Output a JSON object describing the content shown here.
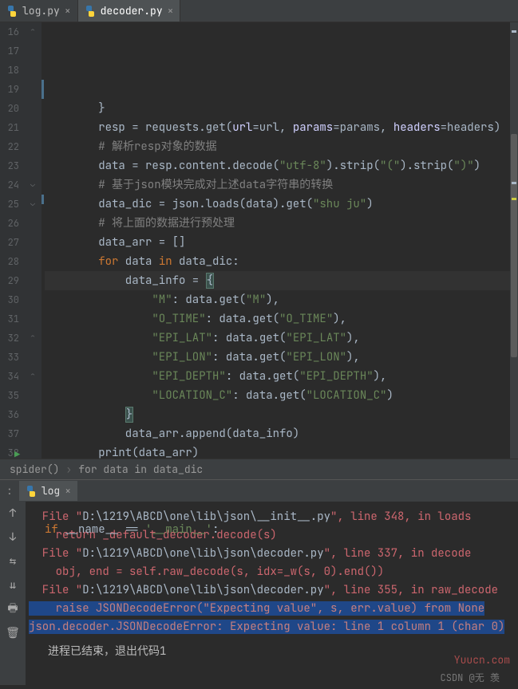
{
  "tabs": {
    "items": [
      {
        "label": "log.py",
        "active": false
      },
      {
        "label": "decoder.py",
        "active": true
      }
    ]
  },
  "gutter": {
    "start": 16,
    "end": 38
  },
  "code": {
    "lines": [
      {
        "n": 16,
        "html": "        }"
      },
      {
        "n": 17,
        "html": "        resp = requests.get(<span class='param'>url</span>=url, <span class='param'>params</span>=params, <span class='param'>headers</span>=headers)"
      },
      {
        "n": 18,
        "html": "        <span class='cmt'># 解析resp对象的数据</span>"
      },
      {
        "n": 19,
        "html": "        data = resp.content.decode(<span class='str'>\"utf-8\"</span>).strip(<span class='str'>\"(\"</span>).strip(<span class='str'>\")\"</span>)"
      },
      {
        "n": 20,
        "html": "        <span class='cmt'># 基于json模块完成对上述data字符串的转换</span>"
      },
      {
        "n": 21,
        "html": "        data_dic = json.loads(data).get(<span class='str'>\"shu ju\"</span>)"
      },
      {
        "n": 22,
        "html": "        <span class='cmt'># 将上面的数据进行预处理</span>"
      },
      {
        "n": 23,
        "html": "        data_arr = []"
      },
      {
        "n": 24,
        "html": "        <span class='kw'>for</span> data <span class='kw'>in</span> data_dic:"
      },
      {
        "n": 25,
        "html": "            data_info = <span class='brace-hl'>{</span>",
        "current": true
      },
      {
        "n": 26,
        "html": "                <span class='str'>\"M\"</span>: data.get(<span class='str'>\"M\"</span>),"
      },
      {
        "n": 27,
        "html": "                <span class='str'>\"O_TIME\"</span>: data.get(<span class='str'>\"O_TIME\"</span>),"
      },
      {
        "n": 28,
        "html": "                <span class='str'>\"EPI_LAT\"</span>: data.get(<span class='str'>\"EPI_LAT\"</span>),"
      },
      {
        "n": 29,
        "html": "                <span class='str'>\"EPI_LON\"</span>: data.get(<span class='str'>\"EPI_LON\"</span>),"
      },
      {
        "n": 30,
        "html": "                <span class='str'>\"EPI_DEPTH\"</span>: data.get(<span class='str'>\"EPI_DEPTH\"</span>),"
      },
      {
        "n": 31,
        "html": "                <span class='str'>\"LOCATION_C\"</span>: data.get(<span class='str'>\"LOCATION_C\"</span>)"
      },
      {
        "n": 32,
        "html": "            <span class='brace-hl'>}</span>"
      },
      {
        "n": 33,
        "html": "            data_arr.append(data_info)"
      },
      {
        "n": 34,
        "html": "        <span class='fn'>print</span>(data_arr)"
      },
      {
        "n": 35,
        "html": ""
      },
      {
        "n": 36,
        "html": ""
      },
      {
        "n": 37,
        "html": ""
      },
      {
        "n": 38,
        "html": "<span class='kw'>if</span> __name__ == <span class='str'>'__main__'</span>:"
      }
    ]
  },
  "breadcrumb": {
    "items": [
      "spider()",
      "for data in data_dic"
    ]
  },
  "tool_window": {
    "prefix": ":",
    "tab_label": "log"
  },
  "console": {
    "lines": [
      {
        "prefix": "  File \"",
        "file": "D:\\1219\\ABCD\\one\\lib\\json\\__init__.py",
        "suffix": "\", line 348, in loads"
      },
      {
        "text": "    return _default_decoder.decode(s)"
      },
      {
        "prefix": "  File \"",
        "file": "D:\\1219\\ABCD\\one\\lib\\json\\decoder.py",
        "suffix": "\", line 337, in decode"
      },
      {
        "text": "    obj, end = self.raw_decode(s, idx=_w(s, 0).end())"
      },
      {
        "prefix": "  File \"",
        "file": "D:\\1219\\ABCD\\one\\lib\\json\\decoder.py",
        "suffix": "\", line 355, in raw_decode"
      },
      {
        "hl": true,
        "text": "    raise JSONDecodeError(\"Expecting value\", s, err.value) from None"
      },
      {
        "hl": true,
        "text": "json.decoder.JSONDecodeError: Expecting value: line 1 column 1 (char 0)"
      }
    ],
    "status": "进程已结束，退出代码1"
  },
  "watermark": "Yuucn.com",
  "csdn": "CSDN @无 羡ᅟᅠ"
}
